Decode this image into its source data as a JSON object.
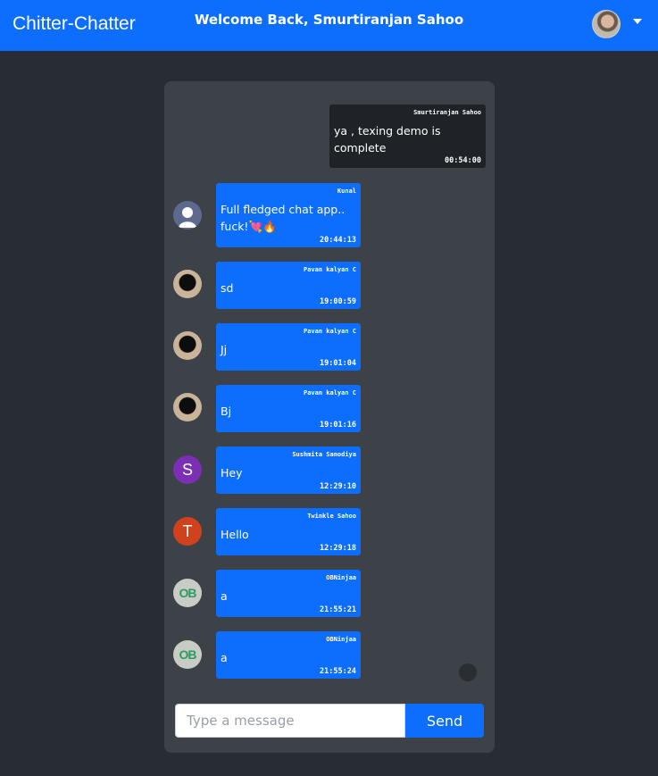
{
  "navbar": {
    "brand": "Chitter-Chatter",
    "welcome": "Welcome Back, Smurtiranjan Sahoo",
    "avatar_icon": "user-avatar",
    "dropdown_icon": "caret-down-icon"
  },
  "messages": [
    {
      "own": true,
      "sender": "Smurtiranjan Sahoo",
      "text": "ya , texing demo is complete",
      "time": "00:54:00"
    },
    {
      "own": false,
      "sender": "Kunal",
      "text": "Full fledged chat app.. fuck!💘🔥",
      "time": "20:44:13",
      "avatar": "default-user-icon"
    },
    {
      "own": false,
      "sender": "Pavan kalyan C",
      "text": "sd",
      "time": "19:00:59",
      "avatar": "profile-photo"
    },
    {
      "own": false,
      "sender": "Pavan kalyan C",
      "text": "Jj",
      "time": "19:01:04",
      "avatar": "profile-photo"
    },
    {
      "own": false,
      "sender": "Pavan kalyan C",
      "text": "Bj",
      "time": "19:01:16",
      "avatar": "profile-photo"
    },
    {
      "own": false,
      "sender": "Sushmita Sanodiya",
      "text": "Hey",
      "time": "12:29:10",
      "avatar": "initial",
      "initial": "S",
      "avatar_color": "#7b2fb5"
    },
    {
      "own": false,
      "sender": "Twinkle Sahoo",
      "text": "Hello",
      "time": "12:29:18",
      "avatar": "initial",
      "initial": "T",
      "avatar_color": "#d0421b"
    },
    {
      "own": false,
      "sender": "OBNinjaa",
      "text": "a",
      "time": "21:55:21",
      "avatar": "ob-logo",
      "initial": "OB"
    },
    {
      "own": false,
      "sender": "OBNinjaa",
      "text": "a",
      "time": "21:55:24",
      "avatar": "ob-logo",
      "initial": "OB"
    }
  ],
  "composer": {
    "placeholder": "Type a message",
    "value": "",
    "send_label": "Send"
  },
  "colors": {
    "primary": "#0d6efd",
    "background": "#282c34",
    "card": "#3d4148",
    "own_bubble": "#1f2227"
  }
}
